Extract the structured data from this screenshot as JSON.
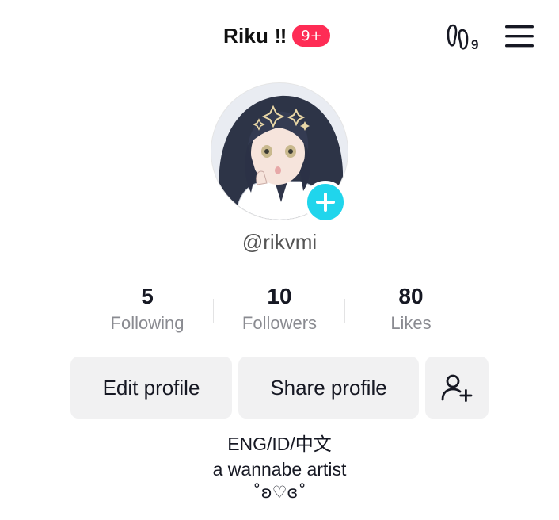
{
  "header": {
    "title": "Riku ‼",
    "notification_badge": "9+",
    "footprint_icon": "footprint-icon",
    "footprint_count": "9",
    "menu_icon": "hamburger-menu-icon"
  },
  "profile": {
    "avatar_icon": "avatar-image",
    "add_avatar_icon": "plus-icon",
    "username": "@rikvmi"
  },
  "stats": [
    {
      "value": "5",
      "label": "Following"
    },
    {
      "value": "10",
      "label": "Followers"
    },
    {
      "value": "80",
      "label": "Likes"
    }
  ],
  "actions": {
    "edit_profile": "Edit profile",
    "share_profile": "Share profile",
    "add_friend_icon": "add-user-icon"
  },
  "bio": {
    "line1": "ENG/ID/中文",
    "line2": "a wannabe artist",
    "line3": "˚ʚ♡ɞ˚"
  },
  "colors": {
    "accent_pink": "#fe2c55",
    "accent_cyan": "#20d5ec",
    "button_bg": "#f1f1f2",
    "secondary_text": "#8a8b91"
  }
}
